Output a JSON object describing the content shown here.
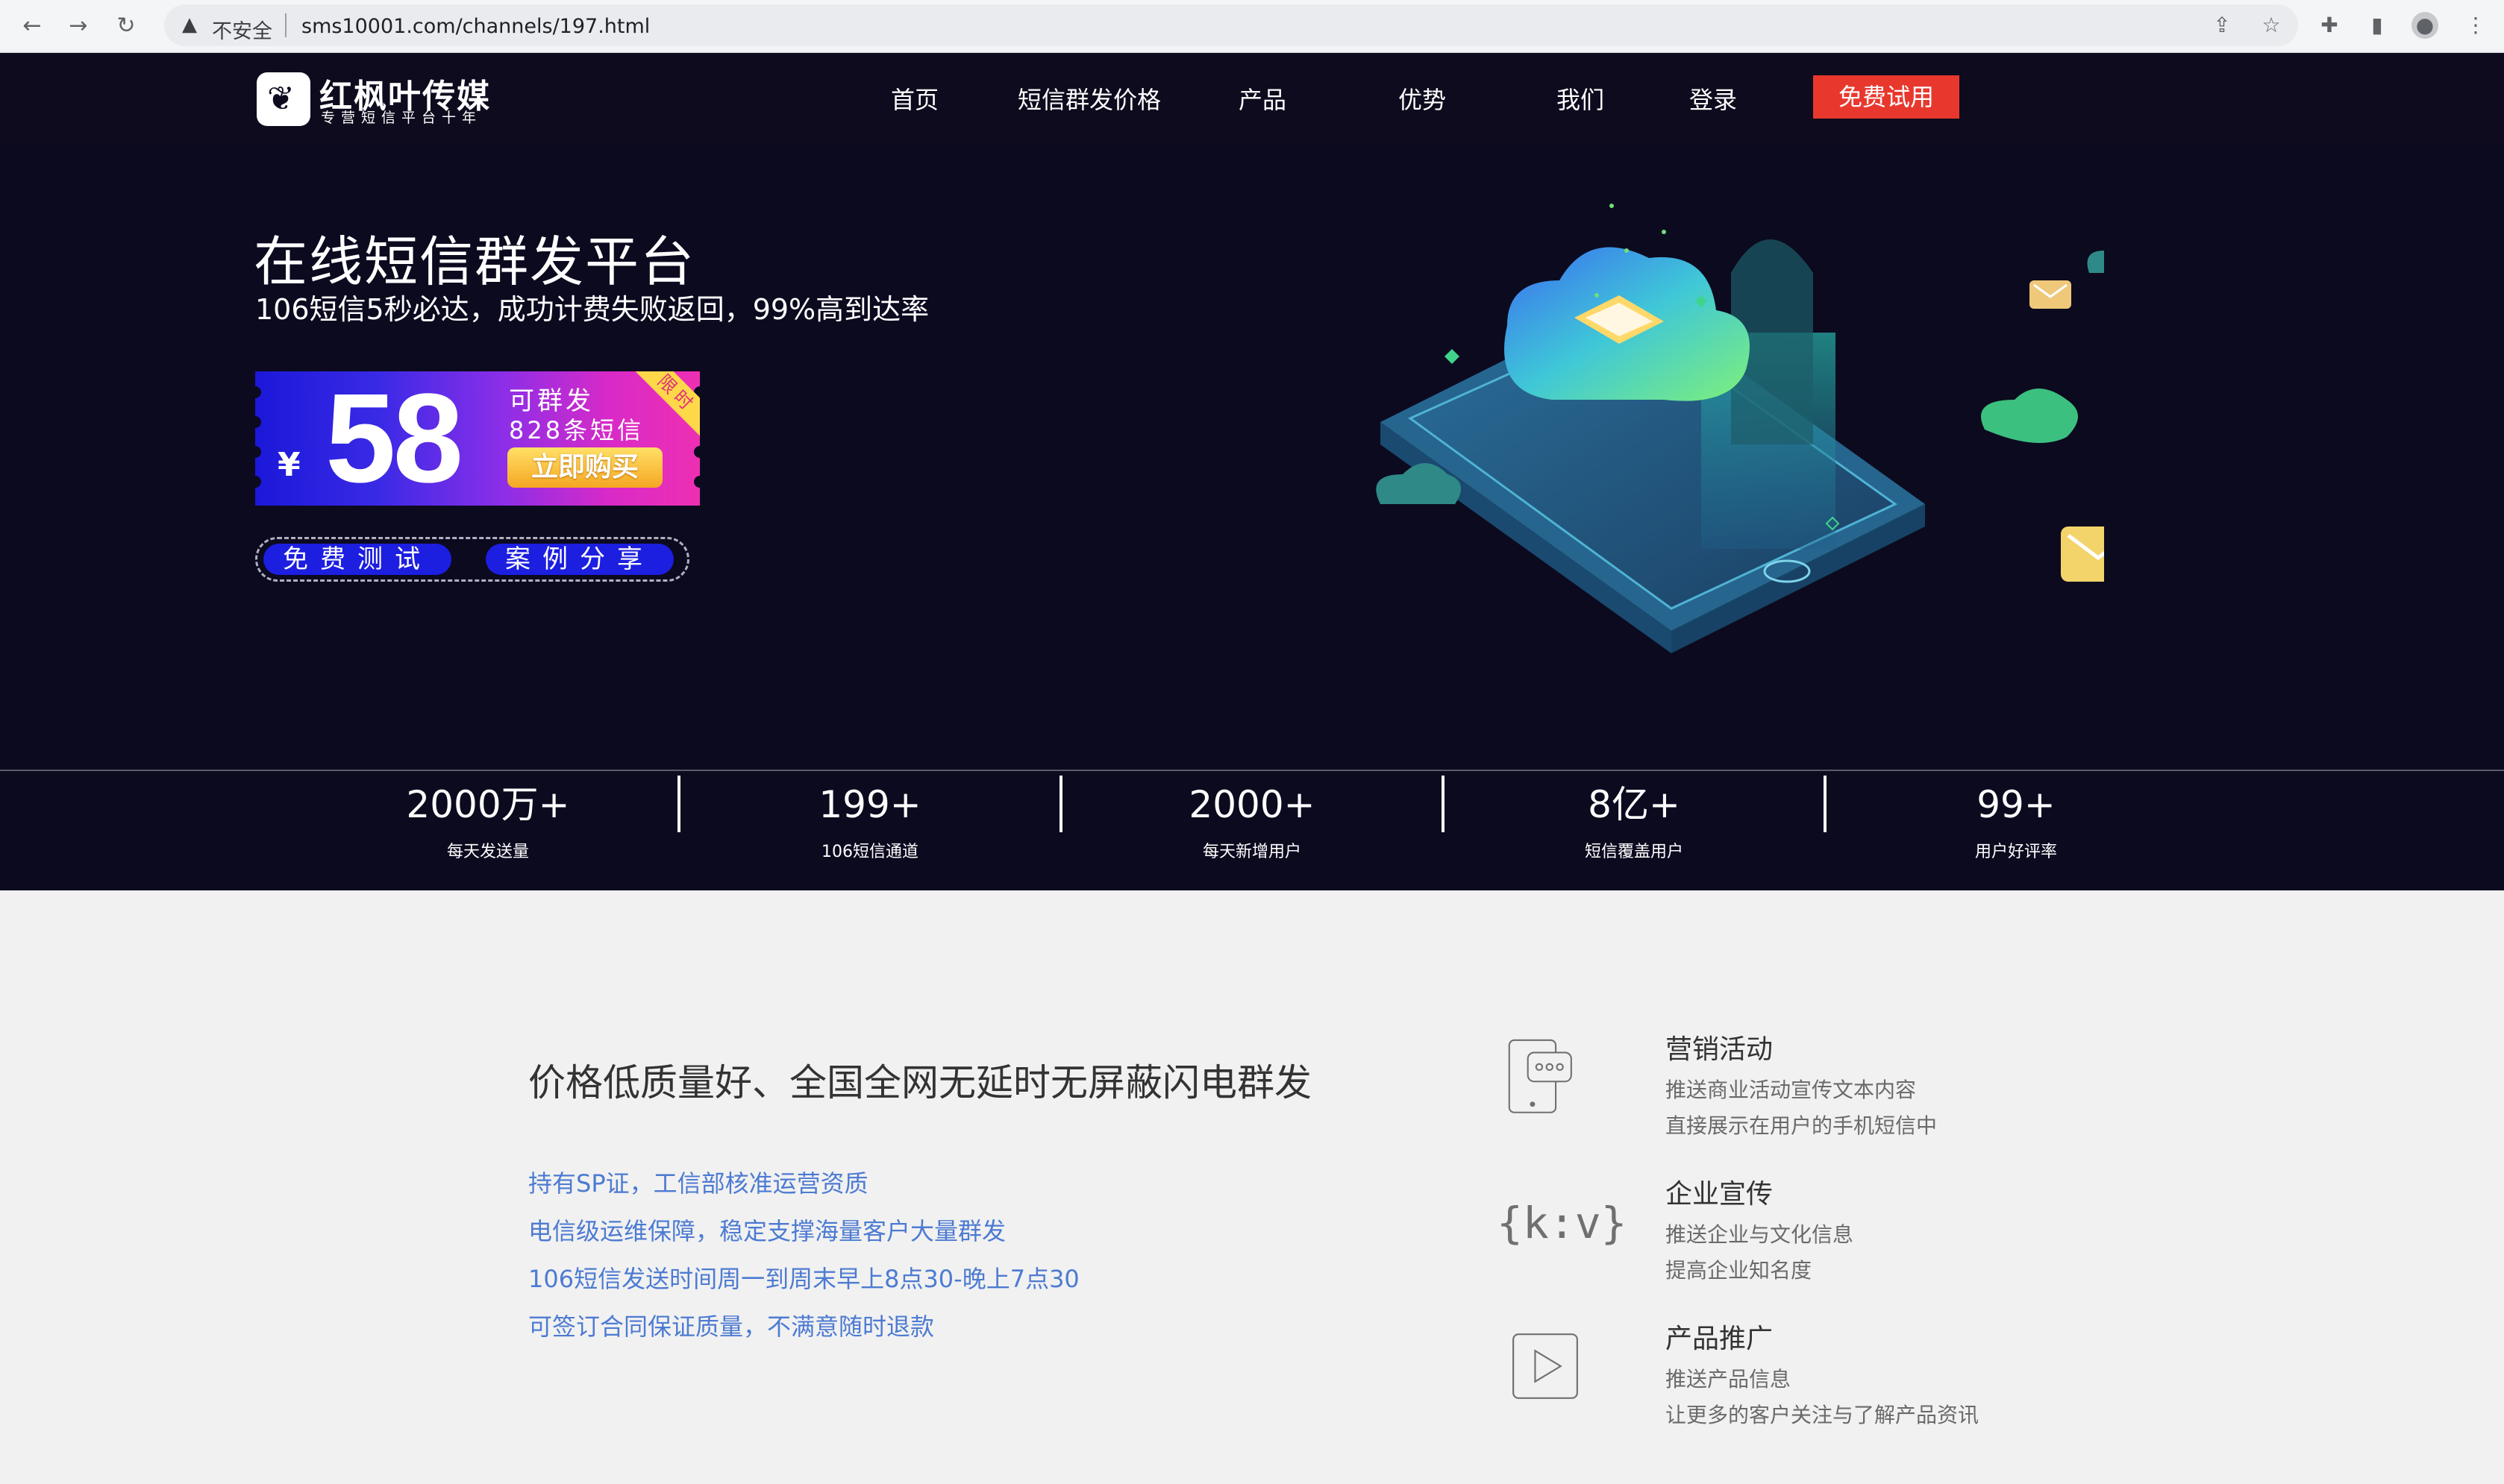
{
  "browser": {
    "back_icon": "arrow-left-icon",
    "forward_icon": "arrow-right-icon",
    "reload_icon": "reload-icon",
    "insecure_label": "不安全",
    "url": "sms10001.com/channels/197.html"
  },
  "header": {
    "logo_name": "红枫叶传媒",
    "logo_tagline": "专营短信平台十年",
    "menu": [
      "首页",
      "短信群发价格",
      "产品",
      "优势",
      "我们",
      "登录"
    ],
    "trial_button": "免费试用"
  },
  "hero": {
    "title": "在线短信群发平台",
    "subtitle": "106短信5秒必达，成功计费失败返回，99%高到达率",
    "promo": {
      "currency": "¥",
      "price": "58",
      "line1": "可群发",
      "line2": "828条短信",
      "buy": "立即购买",
      "ribbon": "限时"
    },
    "pills": [
      "免费测试",
      "案例分享"
    ]
  },
  "stats": [
    {
      "value": "2000万+",
      "label": "每天发送量"
    },
    {
      "value": "199+",
      "label": "106短信通道"
    },
    {
      "value": "2000+",
      "label": "每天新增用户"
    },
    {
      "value": "8亿+",
      "label": "短信覆盖用户"
    },
    {
      "value": "99+",
      "label": "用户好评率"
    }
  ],
  "features": {
    "heading": "价格低质量好、全国全网无延时无屏蔽闪电群发",
    "items": [
      "持有SP证，工信部核准运营资质",
      "电信级运维保障，稳定支撑海量客户大量群发",
      "106短信发送时间周一到周末早上8点30-晚上7点30",
      "可签订合同保证质量，不满意随时退款"
    ]
  },
  "services": [
    {
      "icon": "phone-chat-icon",
      "title": "营销活动",
      "lines": [
        "推送商业活动宣传文本内容",
        "直接展示在用户的手机短信中"
      ]
    },
    {
      "icon": "kv-braces-icon",
      "title": "企业宣传",
      "lines": [
        "推送企业与文化信息",
        "提高企业知名度"
      ]
    },
    {
      "icon": "play-icon",
      "title": "产品推广",
      "lines": [
        "推送产品信息",
        "让更多的客户关注与了解产品资讯"
      ]
    }
  ],
  "colors": {
    "header_bg": "#0d0b1d",
    "trial_red": "#e8382e",
    "feature_blue": "#4d7bd2",
    "page_bg": "#f1f1f1"
  }
}
